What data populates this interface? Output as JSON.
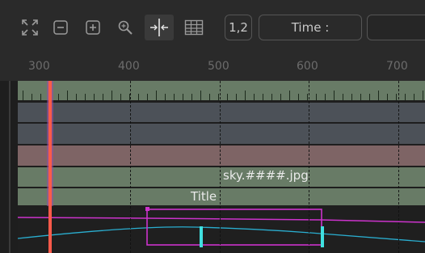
{
  "toolbar": {
    "icons": [
      "fit-icon",
      "zoom-out-icon",
      "zoom-in-icon",
      "zoom-tool-icon",
      "split-icon",
      "grid-icon"
    ],
    "frame_toggle_label": "1,2",
    "time_label": "Time :"
  },
  "ruler": {
    "labels": [
      "300",
      "400",
      "500",
      "600",
      "700"
    ]
  },
  "timeline": {
    "clip_label": "sky.####.jpg",
    "title_label": "Title"
  },
  "colors": {
    "playhead": "#ff5a4a",
    "track_green": "#687b66",
    "track_gray": "#4c5158",
    "track_red": "#7e6465",
    "spline_magenta": "#cc33cc",
    "spline_cyan": "#2aaed0",
    "keyframe": "#40e0e0"
  }
}
